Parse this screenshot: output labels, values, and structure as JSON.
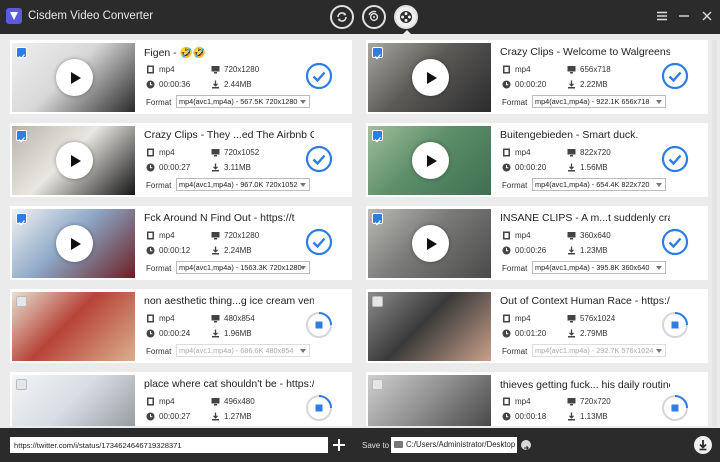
{
  "app": {
    "title": "Cisdem Video Converter",
    "modes": [
      "convert-mode",
      "rip-mode",
      "download-mode"
    ],
    "active_mode": "download-mode"
  },
  "colors": {
    "accent": "#2d7de3",
    "titlebar": "#2b2b2b",
    "background": "#ebebeb"
  },
  "format_label": "Format",
  "videos": [
    {
      "title": "Figen - 🤣🤣",
      "container": "mp4",
      "resolution": "720x1280",
      "duration": "00:00:36",
      "size": "2.44MB",
      "format": "mp4(avc1,mp4a) - 567.5K 720x1280",
      "selected": true,
      "status": "done",
      "thumb_colors": [
        "#d8d8d8",
        "#2a2a2a",
        "#efefef"
      ]
    },
    {
      "title": "Crazy Clips - Welcome to Walgreens",
      "container": "mp4",
      "resolution": "656x718",
      "duration": "00:00:20",
      "size": "2.22MB",
      "format": "mp4(avc1,mp4a) - 922.1K 656x718",
      "selected": true,
      "status": "done",
      "thumb_colors": [
        "#5c5a56",
        "#2b2b2e",
        "#a9a7a0"
      ]
    },
    {
      "title": "Crazy Clips - They ...ed The Airbnb Owner",
      "container": "mp4",
      "resolution": "720x1052",
      "duration": "00:00:27",
      "size": "3.11MB",
      "format": "mp4(avc1,mp4a) - 967.0K 720x1052",
      "selected": true,
      "status": "done",
      "thumb_colors": [
        "#e9e7e1",
        "#151515",
        "#b9b4aa"
      ]
    },
    {
      "title": "Buitengebieden - Smart duck.",
      "container": "mp4",
      "resolution": "822x720",
      "duration": "00:00:20",
      "size": "1.56MB",
      "format": "mp4(avc1,mp4a) - 654.4K 822x720",
      "selected": true,
      "status": "done",
      "thumb_colors": [
        "#5d8f6a",
        "#3e6f52",
        "#9fbf9a"
      ]
    },
    {
      "title": "Fck Around N Find Out - https://t",
      "container": "mp4",
      "resolution": "720x1280",
      "duration": "00:00:12",
      "size": "2.24MB",
      "format": "mp4(avc1,mp4a) - 1563.3K 720x1280",
      "selected": true,
      "status": "done",
      "thumb_colors": [
        "#8ea9c9",
        "#6b1f22",
        "#f1f1f1"
      ]
    },
    {
      "title": "INSANE CLIPS - A m...t suddenly crashed",
      "container": "mp4",
      "resolution": "360x640",
      "duration": "00:00:26",
      "size": "1.23MB",
      "format": "mp4(avc1,mp4a) - 395.8K 360x640",
      "selected": true,
      "status": "done",
      "thumb_colors": [
        "#7a7a78",
        "#4a4a48",
        "#b9b9b6"
      ]
    },
    {
      "title": "non aesthetic thing...g ice cream vendors",
      "container": "mp4",
      "resolution": "480x854",
      "duration": "00:00:24",
      "size": "1.96MB",
      "format": "mp4(avc1,mp4a) - 686.6K 480x854",
      "selected": false,
      "status": "loading",
      "thumb_colors": [
        "#b84338",
        "#d9b08c",
        "#e8e0d2"
      ]
    },
    {
      "title": "Out of Context Human Race - https://t",
      "container": "mp4",
      "resolution": "576x1024",
      "duration": "00:01:20",
      "size": "2.79MB",
      "format": "mp4(avc1,mp4a) - 292.7K 576x1024",
      "selected": false,
      "status": "loading",
      "thumb_colors": [
        "#3a3a3a",
        "#c9a08a",
        "#8c8c8c"
      ]
    },
    {
      "title": "place where cat shouldn't be - https://t",
      "container": "mp4",
      "resolution": "496x480",
      "duration": "00:00:27",
      "size": "1.27MB",
      "format": "",
      "selected": false,
      "status": "loading",
      "thumb_colors": [
        "#d7dde2",
        "#8a8f93",
        "#f3f5f7"
      ]
    },
    {
      "title": "thieves getting fuck... his daily routine 💀",
      "container": "mp4",
      "resolution": "720x720",
      "duration": "00:00:18",
      "size": "1.13MB",
      "format": "",
      "selected": false,
      "status": "loading",
      "thumb_colors": [
        "#8f8f8f",
        "#3a3a3a",
        "#cfcfcf"
      ]
    }
  ],
  "bottom": {
    "url_value": "https://twitter.com/i/status/1734624646719328371",
    "save_to_label": "Save to",
    "save_path": "C:/Users/Administrator/Desktop"
  }
}
